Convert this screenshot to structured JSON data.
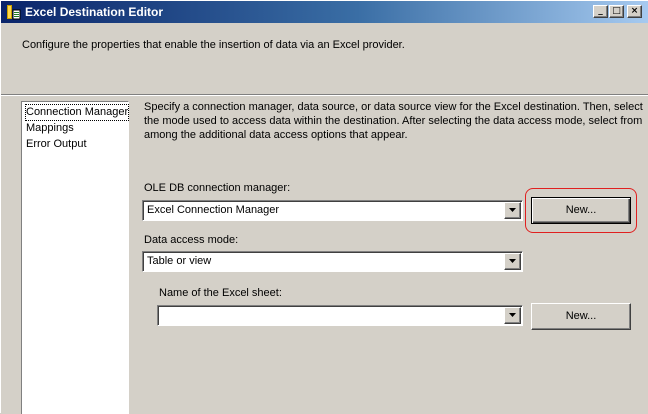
{
  "window": {
    "title": "Excel Destination Editor",
    "controls": {
      "minimize": "_",
      "maximize": "□",
      "close": "×"
    }
  },
  "header": {
    "description": "Configure the properties that enable the insertion of data via an Excel provider."
  },
  "nav": {
    "items": [
      {
        "label": "Connection Manager",
        "selected": true
      },
      {
        "label": "Mappings"
      },
      {
        "label": "Error Output"
      }
    ]
  },
  "main": {
    "description": "Specify a connection manager, data source, or data source view for the Excel destination. Then, select the mode used to access data within the destination. After selecting the data access mode, select from among the additional data access options that appear.",
    "connection_manager": {
      "label": "OLE DB connection manager:",
      "value": "Excel Connection Manager",
      "new_button": "New..."
    },
    "access_mode": {
      "label": "Data access mode:",
      "value": "Table or view"
    },
    "sheet": {
      "label": "Name of the Excel sheet:",
      "value": "",
      "new_button": "New..."
    }
  },
  "colors": {
    "highlight_ring": "#e02020",
    "titlebar": "#0a246a",
    "face": "#d4d0c8"
  }
}
